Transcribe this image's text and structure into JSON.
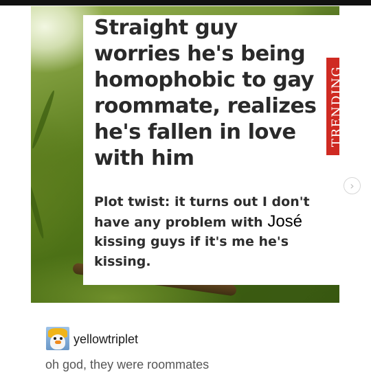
{
  "post": {
    "article": {
      "headline": "Straight guy worries he's being homophobic to gay roommate, realizes he's fallen in love with him",
      "trending_label": "TRENDING",
      "subtext_before": "Plot twist: it turns out I don't have any problem with",
      "subtext_name": "José",
      "subtext_after": "kissing guys if it's me he's kissing."
    },
    "next_button_icon": "chevron-right-icon",
    "next_button_glyph": "›"
  },
  "reblog": {
    "username": "yellowtriplet",
    "caption": "oh god, they were roommates"
  },
  "colors": {
    "trending_tag": "#cf2a22",
    "card_background": "#ffffff",
    "headline_text": "#2a2a2a",
    "caption_text": "#555555"
  }
}
